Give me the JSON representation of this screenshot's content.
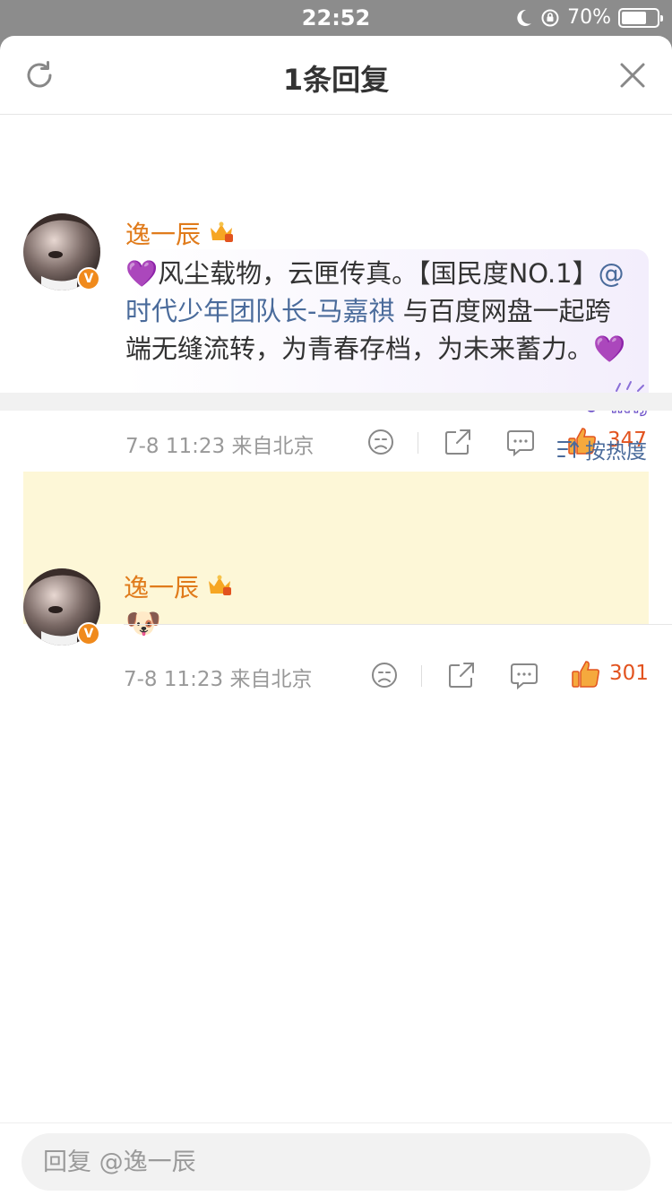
{
  "status_bar": {
    "time": "22:52",
    "battery": "70%",
    "battery_level": 0.7
  },
  "header": {
    "title": "1条回复"
  },
  "main_comment": {
    "username": "逸一辰",
    "text_before": "风尘载物，云匣传真。【国民度NO.1】",
    "mention": "@时代少年团队长-马嘉祺",
    "text_after": " 与百度网盘一起跨端无缝流转，为青春存档，为未来蓄力。",
    "heart_emoji": "💜",
    "time": "7-8 11:23",
    "location": "来自北京",
    "likes": "347",
    "sticker_text": "INTJ"
  },
  "sort": {
    "label": "按热度"
  },
  "reply": {
    "username": "逸一辰",
    "emoji": "🐶",
    "time": "7-8 11:23",
    "location": "来自北京",
    "likes": "301"
  },
  "reply_input": {
    "placeholder": "回复 @逸一辰"
  },
  "colors": {
    "accent": "#e07b1b",
    "like": "#e2531f",
    "link": "#4a6b9b"
  }
}
